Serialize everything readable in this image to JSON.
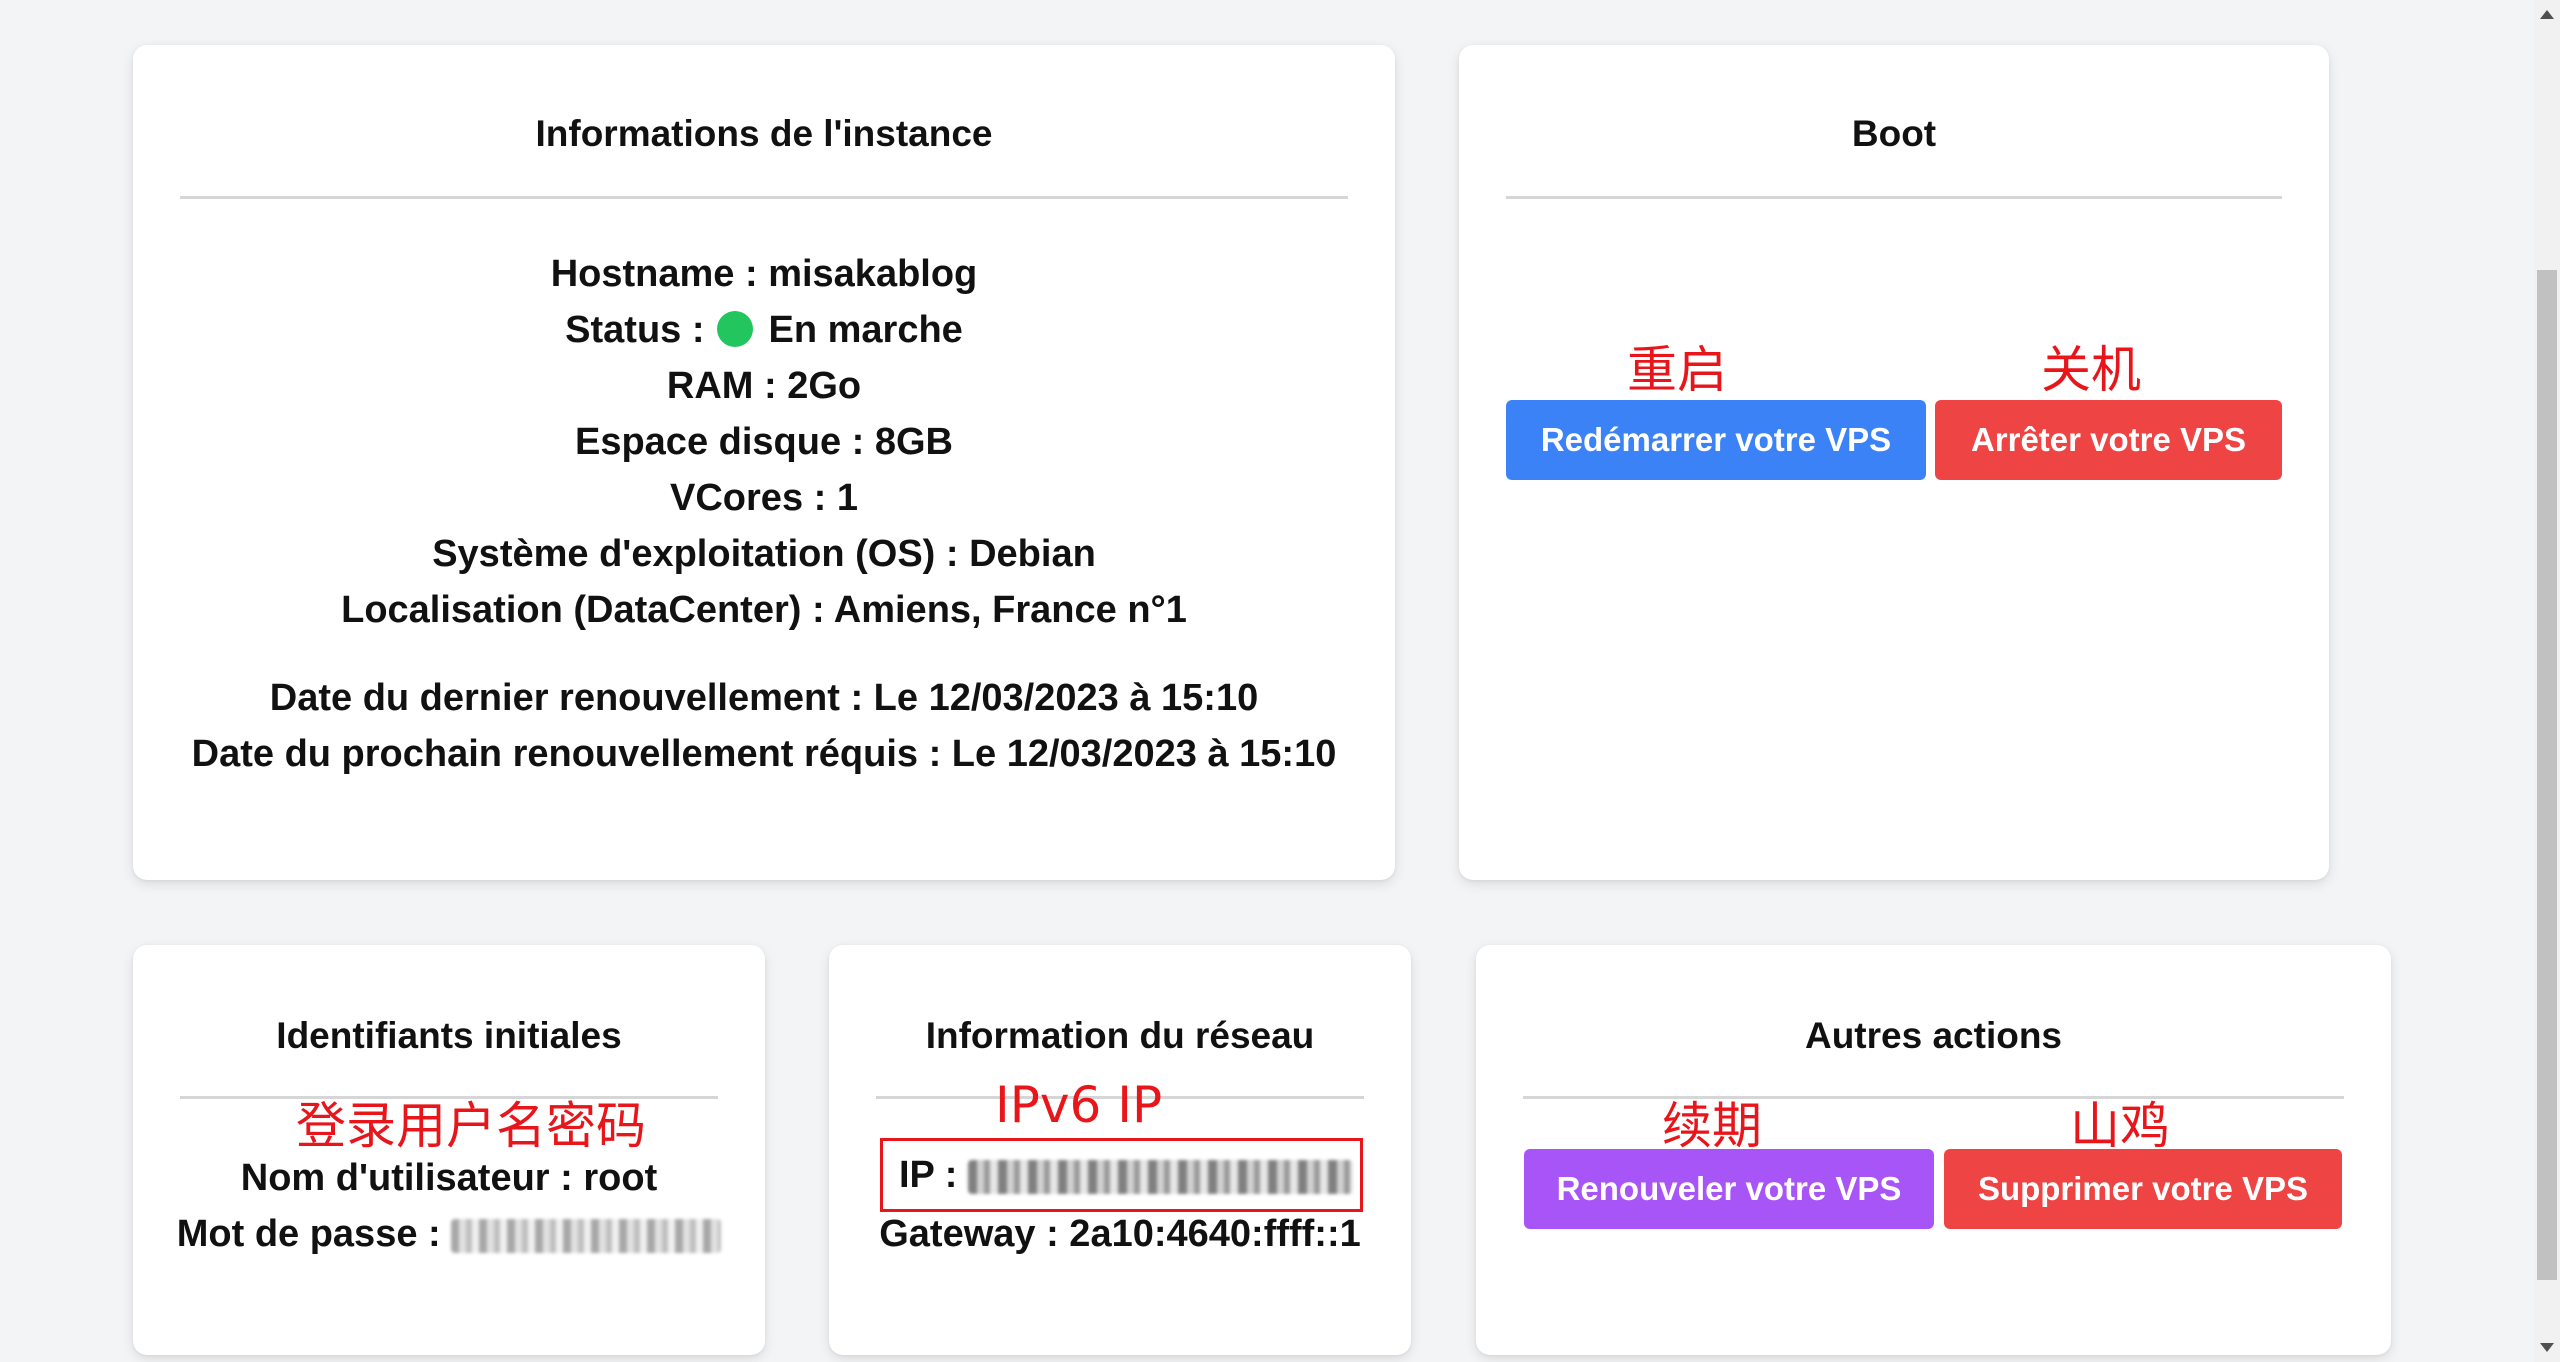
{
  "instance_card": {
    "title": "Informations de l'instance",
    "hostname": "Hostname : misakablog",
    "status_label": "Status :",
    "status_value": "En marche",
    "ram": "RAM : 2Go",
    "disk": "Espace disque : 8GB",
    "vcores": "VCores : 1",
    "os": "Système d'exploitation (OS) : Debian",
    "location": "Localisation (DataCenter) : Amiens, France n°1",
    "last_renewal": "Date du dernier renouvellement : Le 12/03/2023 à 15:10",
    "next_renewal": "Date du prochain renouvellement réquis : Le 12/03/2023 à 15:10"
  },
  "boot_card": {
    "title": "Boot",
    "restart_button": "Redémarrer votre VPS",
    "stop_button": "Arrêter votre VPS",
    "annot_restart": "重启",
    "annot_stop": "关机"
  },
  "credentials_card": {
    "title": "Identifiants initiales",
    "annot": "登录用户名密码",
    "username": "Nom d'utilisateur : root",
    "password_label": "Mot de passe :"
  },
  "network_card": {
    "title": "Information du réseau",
    "annot": "IPv6 IP",
    "ip_label": "IP :",
    "gateway": "Gateway : 2a10:4640:ffff::1"
  },
  "actions_card": {
    "title": "Autres actions",
    "renew_button": "Renouveler votre VPS",
    "delete_button": "Supprimer votre VPS",
    "annot_renew": "续期",
    "annot_delete": "山鸡"
  },
  "colors": {
    "status_dot": "#22c55e",
    "restart": "#3b82f6",
    "stop": "#ef4444",
    "renew": "#a855f7",
    "delete": "#ef4444",
    "annotation": "#e8161a"
  }
}
